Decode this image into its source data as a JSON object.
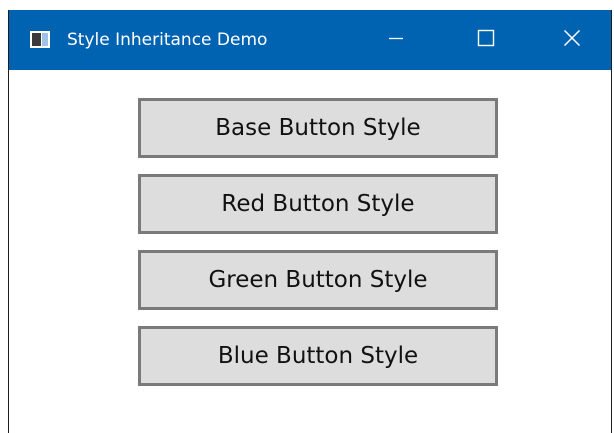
{
  "window": {
    "title": "Style Inheritance Demo",
    "titlebar_color": "#0063b1",
    "app_icon": "app-window-icon",
    "minimize_icon": "minimize-icon",
    "maximize_icon": "maximize-icon",
    "close_icon": "close-icon"
  },
  "buttons": [
    {
      "label": "Base Button Style"
    },
    {
      "label": "Red Button Style"
    },
    {
      "label": "Green Button Style"
    },
    {
      "label": "Blue Button Style"
    }
  ],
  "colors": {
    "button_background": "#dddddd",
    "button_border": "#7a7a7a",
    "content_background": "#ffffff"
  }
}
